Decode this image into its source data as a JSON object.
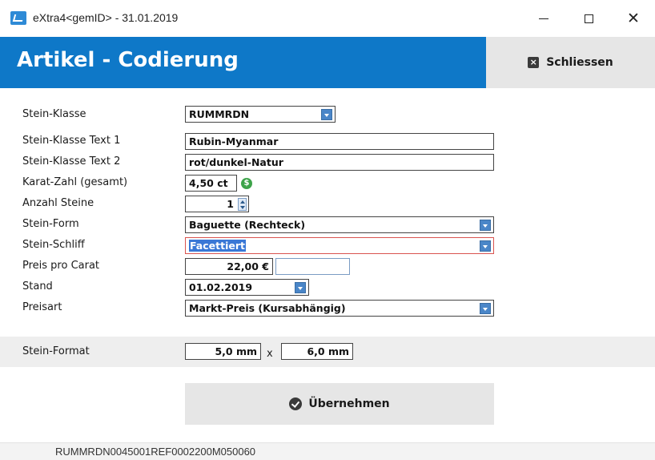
{
  "window": {
    "title": "eXtra4<gemID>  -  31.01.2019",
    "minimize_icon": "minimize-icon",
    "maximize_icon": "maximize-icon",
    "close_icon": "close-icon"
  },
  "header": {
    "title": "Artikel - Codierung",
    "close_button_label": "Schliessen",
    "accent_color": "#0e78c8"
  },
  "form": {
    "stein_klasse": {
      "label": "Stein-Klasse",
      "value": "RUMMRDN"
    },
    "stein_klasse_text1": {
      "label": "Stein-Klasse Text 1",
      "value": "Rubin-Myanmar"
    },
    "stein_klasse_text2": {
      "label": "Stein-Klasse Text 2",
      "value": "rot/dunkel-Natur"
    },
    "karat_zahl": {
      "label": "Karat-Zahl (gesamt)",
      "value": "4,50 ct",
      "icon": "dollar-icon"
    },
    "anzahl_steine": {
      "label": "Anzahl Steine",
      "value": "1"
    },
    "stein_form": {
      "label": "Stein-Form",
      "value": "Baguette (Rechteck)"
    },
    "stein_schliff": {
      "label": "Stein-Schliff",
      "value": "Facettiert"
    },
    "preis_pro_carat": {
      "label": "Preis pro Carat",
      "value": "22,00 €",
      "extra_value": ""
    },
    "stand": {
      "label": "Stand",
      "value": "01.02.2019"
    },
    "preisart": {
      "label": "Preisart",
      "value": "Markt-Preis (Kursabhängig)"
    },
    "stein_format": {
      "label": "Stein-Format",
      "width": "5,0 mm",
      "separator": "x",
      "height": "6,0 mm"
    }
  },
  "actions": {
    "apply_label": "Übernehmen"
  },
  "status": {
    "code": "RUMMRDN0045001REF0002200M050060"
  }
}
